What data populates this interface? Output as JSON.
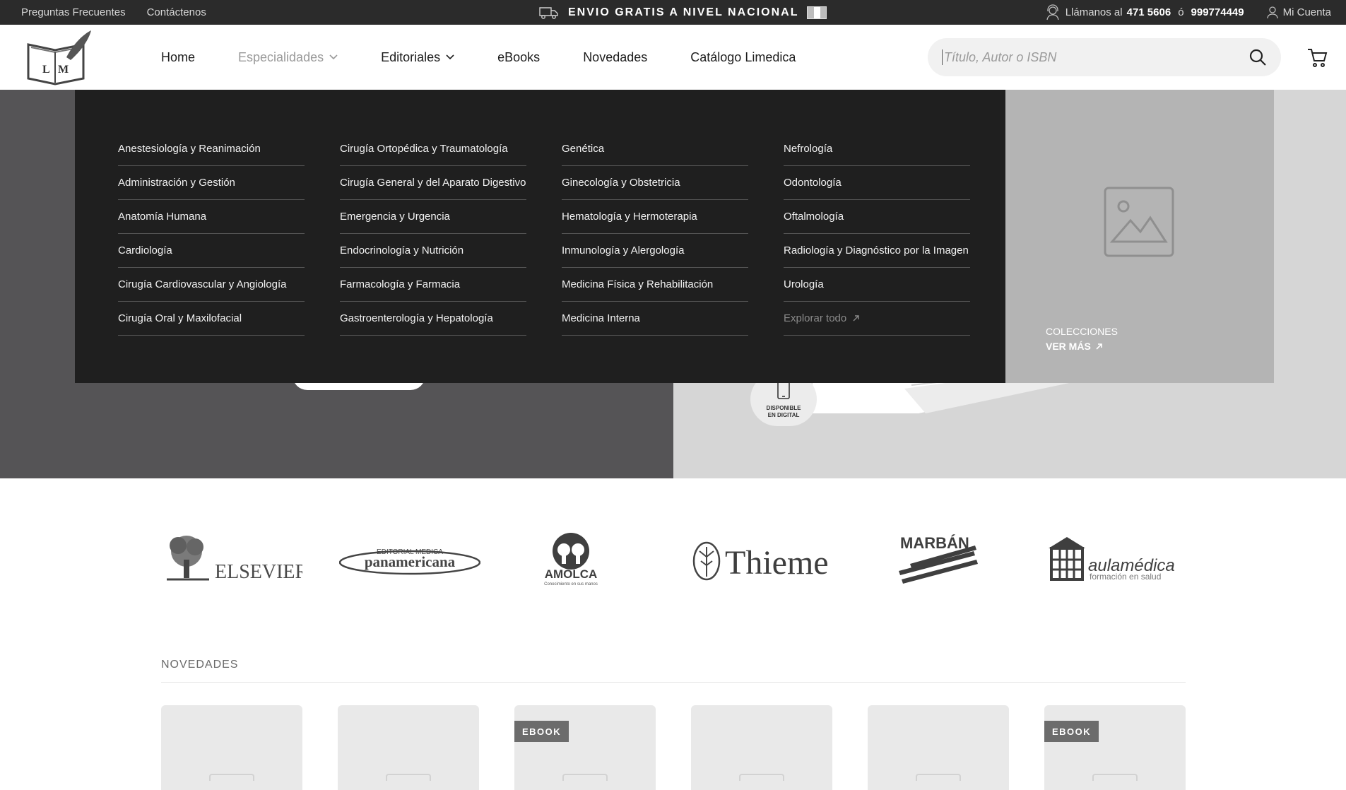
{
  "topbar": {
    "links": [
      "Preguntas Frecuentes",
      "Contáctenos"
    ],
    "promo": "ENVIO GRATIS A NIVEL NACIONAL",
    "call_label": "Llámanos al",
    "phone_1": "471 5606",
    "or": "ó",
    "phone_2": "999774449",
    "account": "Mi Cuenta"
  },
  "logo": {
    "text": "LM"
  },
  "nav": {
    "items": [
      "Home",
      "Especialidades",
      "Editoriales",
      "eBooks",
      "Novedades",
      "Catálogo Limedica"
    ]
  },
  "search": {
    "placeholder": "Título, Autor o ISBN"
  },
  "mega": {
    "columns": [
      [
        "Anestesiología y Reanimación",
        "Administración y Gestión",
        "Anatomía Humana",
        "Cardiología",
        "Cirugía Cardiovascular y Angiología",
        "Cirugía Oral y Maxilofacial"
      ],
      [
        "Cirugía Ortopédica y Traumatología",
        "Cirugía General y del Aparato Digestivo",
        "Emergencia y Urgencia",
        "Endocrinología y Nutrición",
        "Farmacología y Farmacia",
        "Gastroenterología y Hepatología"
      ],
      [
        "Genética",
        "Ginecología y Obstetricia",
        "Hematología y Hermoterapia",
        "Inmunología y Alergología",
        "Medicina Física y Rehabilitación",
        "Medicina Interna"
      ],
      [
        "Nefrología",
        "Odontología",
        "Oftalmología",
        "Radiología y Diagnóstico por la Imagen",
        "Urología"
      ]
    ],
    "explore": "Explorar todo",
    "side_title": "COLECCIONES",
    "side_more": "VER MÁS"
  },
  "hero": {
    "badge": "DISPONIBLE EN DIGITAL"
  },
  "brands": [
    {
      "name": "ELSEVIER"
    },
    {
      "top": "EDITORIAL MEDICA",
      "name": "panamericana"
    },
    {
      "name": "AMOLCA",
      "sub": "Conocimiento en sus manos"
    },
    {
      "name": "Thieme"
    },
    {
      "name": "MARBÁN"
    },
    {
      "name": "aulamédica",
      "sub": "formación en salud"
    }
  ],
  "novedades": {
    "title": "NOVEDADES",
    "cards": [
      {
        "tag": ""
      },
      {
        "tag": ""
      },
      {
        "tag": "EBOOK"
      },
      {
        "tag": ""
      },
      {
        "tag": ""
      },
      {
        "tag": "EBOOK"
      }
    ]
  },
  "colors": {
    "topbar": "#2b2b2b",
    "mega": "#1f1f1f",
    "hero_left": "#555456",
    "hero_right": "#d6d6d6"
  }
}
